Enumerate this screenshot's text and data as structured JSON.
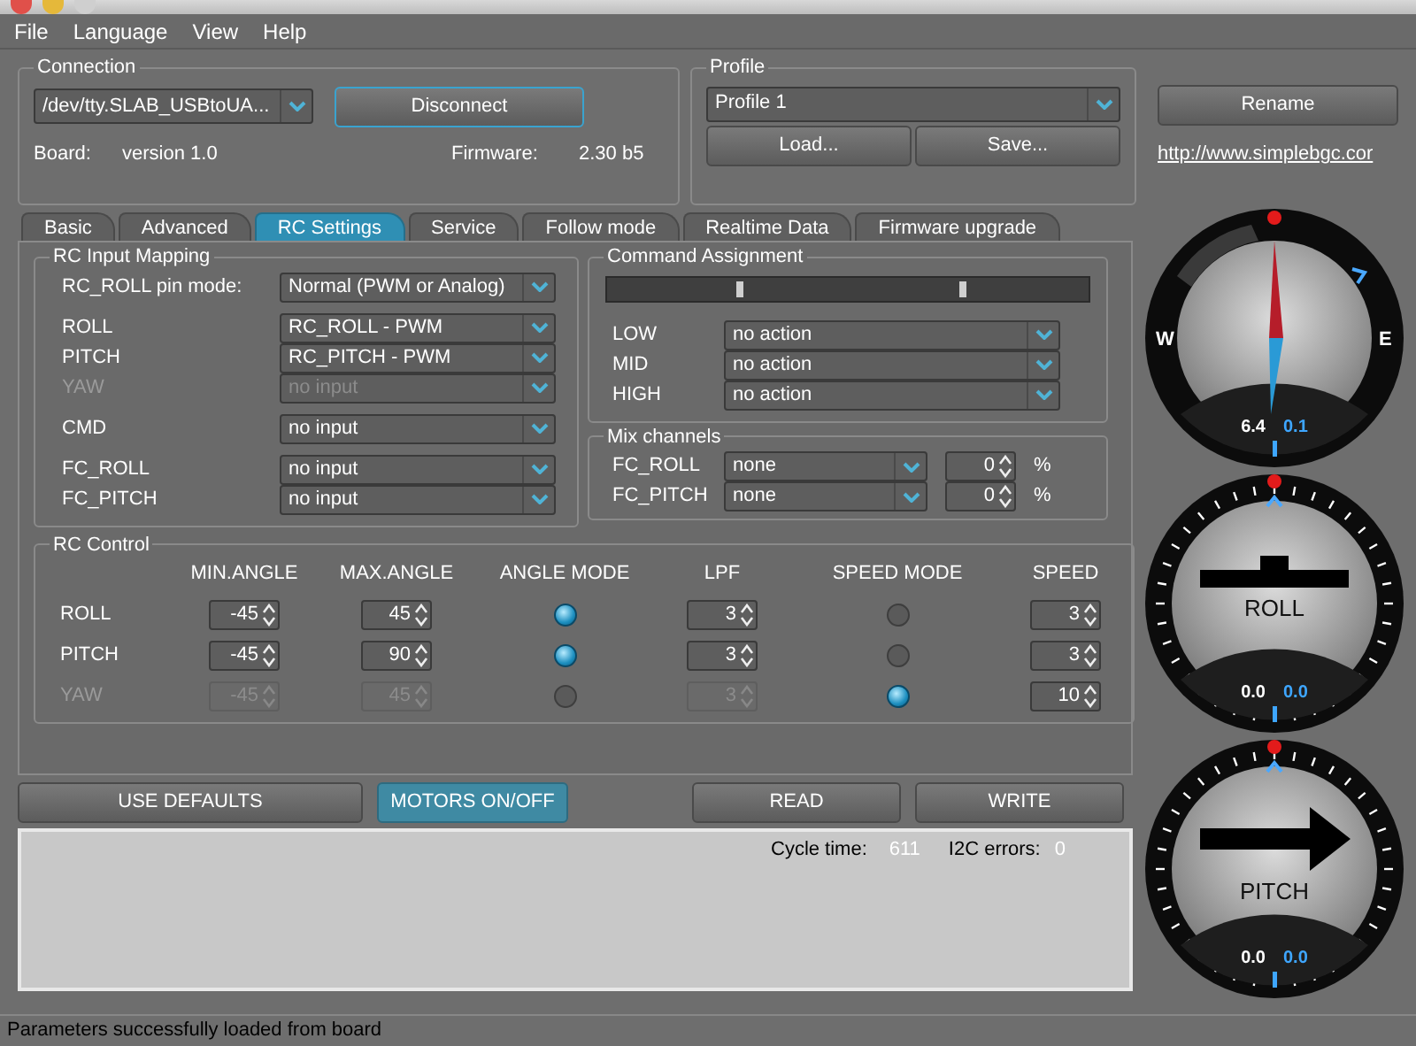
{
  "menu": [
    "File",
    "Language",
    "View",
    "Help"
  ],
  "connection": {
    "title": "Connection",
    "port": "/dev/tty.SLAB_USBtoUA...",
    "button": "Disconnect",
    "board_label": "Board:",
    "board_value": "version 1.0",
    "firmware_label": "Firmware:",
    "firmware_value": "2.30 b5"
  },
  "profile": {
    "title": "Profile",
    "selected_profile": "Profile 1",
    "rename_button": "Rename",
    "load_button": "Load...",
    "save_button": "Save...",
    "link": "http://www.simplebgc.cor"
  },
  "tabs": [
    {
      "label": "Basic",
      "selected": false
    },
    {
      "label": "Advanced",
      "selected": false
    },
    {
      "label": "RC Settings",
      "selected": true
    },
    {
      "label": "Service",
      "selected": false
    },
    {
      "label": "Follow mode",
      "selected": false
    },
    {
      "label": "Realtime Data",
      "selected": false
    },
    {
      "label": "Firmware upgrade",
      "selected": false
    }
  ],
  "rc_input_mapping": {
    "title": "RC Input Mapping",
    "groups": [
      [
        {
          "label": "RC_ROLL pin mode:",
          "value": "Normal (PWM or Analog)",
          "disabled": false
        }
      ],
      [
        {
          "label": "ROLL",
          "value": "RC_ROLL - PWM",
          "disabled": false
        },
        {
          "label": "PITCH",
          "value": "RC_PITCH - PWM",
          "disabled": false
        },
        {
          "label": "YAW",
          "value": "no input",
          "disabled": true
        }
      ],
      [
        {
          "label": "CMD",
          "value": "no input",
          "disabled": false
        }
      ],
      [
        {
          "label": "FC_ROLL",
          "value": "no input",
          "disabled": false
        },
        {
          "label": "FC_PITCH",
          "value": "no input",
          "disabled": false
        }
      ]
    ]
  },
  "command_assignment": {
    "title": "Command Assignment",
    "thresholds": [
      {
        "level": 0.27
      },
      {
        "level": 0.73
      }
    ],
    "rows": [
      {
        "label": "LOW",
        "value": "no action"
      },
      {
        "label": "MID",
        "value": "no action"
      },
      {
        "label": "HIGH",
        "value": "no action"
      }
    ]
  },
  "mix_channels": {
    "title": "Mix channels",
    "rows": [
      {
        "label": "FC_ROLL",
        "value": "none",
        "amount": "0",
        "unit": "%"
      },
      {
        "label": "FC_PITCH",
        "value": "none",
        "amount": "0",
        "unit": "%"
      }
    ]
  },
  "rc_control": {
    "title": "RC Control",
    "columns": [
      "MIN.ANGLE",
      "MAX.ANGLE",
      "ANGLE MODE",
      "LPF",
      "SPEED MODE",
      "SPEED"
    ],
    "rows": [
      {
        "label": "ROLL",
        "disabled": false,
        "min_angle": {
          "value": "-45",
          "disabled": false
        },
        "max_angle": {
          "value": "45",
          "disabled": false
        },
        "angle_mode": {
          "selected": true
        },
        "lpf": {
          "value": "3",
          "disabled": false
        },
        "speed_mode": {
          "selected": false
        },
        "speed": {
          "value": "3",
          "disabled": false
        }
      },
      {
        "label": "PITCH",
        "disabled": false,
        "min_angle": {
          "value": "-45",
          "disabled": false
        },
        "max_angle": {
          "value": "90",
          "disabled": false
        },
        "angle_mode": {
          "selected": true
        },
        "lpf": {
          "value": "3",
          "disabled": false
        },
        "speed_mode": {
          "selected": false
        },
        "speed": {
          "value": "3",
          "disabled": false
        }
      },
      {
        "label": "YAW",
        "disabled": true,
        "min_angle": {
          "value": "-45",
          "disabled": true
        },
        "max_angle": {
          "value": "45",
          "disabled": true
        },
        "angle_mode": {
          "selected": false
        },
        "lpf": {
          "value": "3",
          "disabled": true
        },
        "speed_mode": {
          "selected": true
        },
        "speed": {
          "value": "10",
          "disabled": false
        }
      }
    ]
  },
  "buttons": [
    {
      "label": "USE DEFAULTS",
      "highlighted": false
    },
    {
      "label": "MOTORS ON/OFF",
      "highlighted": true
    },
    {
      "label": "READ",
      "highlighted": false
    },
    {
      "label": "WRITE",
      "highlighted": false
    }
  ],
  "log": {
    "cycle_time_label": "Cycle time:",
    "cycle_time": "611",
    "i2c_label": "I2C errors:",
    "i2c_errors": "0"
  },
  "gauges": [
    {
      "kind": "compass",
      "west": "W",
      "east": "E",
      "value": "6.4",
      "target": "0.1"
    },
    {
      "kind": "roll",
      "label": "ROLL",
      "value": "0.0",
      "target": "0.0"
    },
    {
      "kind": "pitch",
      "label": "PITCH",
      "value": "0.0",
      "target": "0.0"
    }
  ],
  "status_bar": "Parameters successfully loaded from board"
}
